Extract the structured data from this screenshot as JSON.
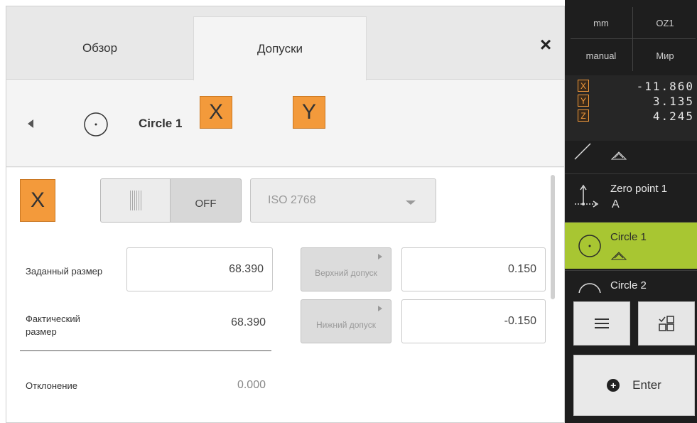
{
  "tabs": [
    {
      "label": "Обзор"
    },
    {
      "label": "Допуски"
    }
  ],
  "close_icon": "×",
  "feature": {
    "name": "Circle 1",
    "axis_buttons": [
      "X",
      "Y"
    ]
  },
  "tolerance": {
    "axis": "X",
    "toggle_label": "OFF",
    "standard": "ISO 2768",
    "nominal_label": "Заданный размер",
    "nominal_value": "68.390",
    "actual_label": "Фактический размер",
    "actual_value": "68.390",
    "deviation_label": "Отклонение",
    "deviation_value": "0.000",
    "upper_label": "Верхний допуск",
    "upper_value": "0.150",
    "lower_label": "Нижний допуск",
    "lower_value": "-0.150"
  },
  "status": {
    "unit": "mm",
    "coord_system": "OZ1",
    "mode": "manual",
    "frame": "Мир"
  },
  "positions": [
    {
      "axis": "X",
      "value": "-11.860"
    },
    {
      "axis": "Y",
      "value": "3.135"
    },
    {
      "axis": "Z",
      "value": "4.245"
    }
  ],
  "feature_list": [
    {
      "label": "Zero point 1",
      "icon": "zero-point-icon"
    },
    {
      "label": "Circle 1",
      "icon": "circle-icon",
      "selected": true
    },
    {
      "label": "Circle 2",
      "icon": "circle-icon"
    }
  ],
  "enter_label": "Enter",
  "colors": {
    "accent_orange": "#f39a3b",
    "selected_green": "#a8c632",
    "dark_panel": "#1e1e1e"
  }
}
